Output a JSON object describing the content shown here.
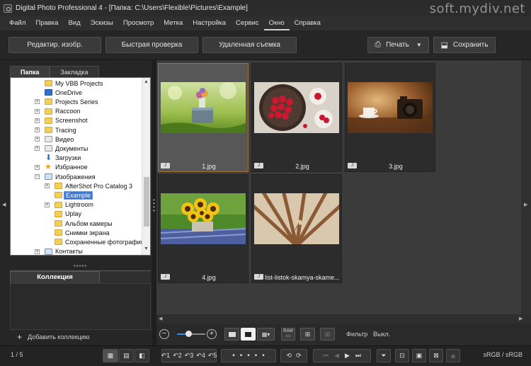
{
  "window": {
    "title": "Digital Photo Professional 4 - [Папка: C:\\Users\\Flexible\\Pictures\\Example]",
    "watermark": "soft.mydiv.net",
    "minimize": "─",
    "maximize": "☐",
    "close": "✕"
  },
  "menu": [
    "Файл",
    "Правка",
    "Вид",
    "Эскизы",
    "Просмотр",
    "Метка",
    "Настройка",
    "Сервис",
    "Окно",
    "Справка"
  ],
  "toolbar": {
    "edit_image": "Редактир. изобр.",
    "quick_check": "Быстрая проверка",
    "remote_shooting": "Удаленная съемка",
    "print": "Печать",
    "save": "Сохранить",
    "print_icon": "⎙",
    "save_icon": "⬓",
    "dropdown": "▼"
  },
  "left_panel": {
    "tab_folder": "Папка",
    "tab_bookmark": "Закладка",
    "tree": [
      {
        "label": "My VBB Projects",
        "icon": "folder",
        "expander": ""
      },
      {
        "label": "OneDrive",
        "icon": "folder-blue",
        "expander": ""
      },
      {
        "label": "Projects Series",
        "icon": "folder",
        "expander": "+"
      },
      {
        "label": "Raccoon",
        "icon": "folder",
        "expander": "+"
      },
      {
        "label": "Screenshot",
        "icon": "folder",
        "expander": "+"
      },
      {
        "label": "Tracing",
        "icon": "folder",
        "expander": "+"
      },
      {
        "label": "Видео",
        "icon": "folder-docs",
        "expander": "+"
      },
      {
        "label": "Документы",
        "icon": "folder-docs",
        "expander": "+"
      },
      {
        "label": "Загрузки",
        "icon": "download",
        "expander": ""
      },
      {
        "label": "Избранное",
        "icon": "star",
        "expander": "+"
      },
      {
        "label": "Изображения",
        "icon": "folder-img",
        "expander": "−"
      },
      {
        "label": "AfterShot Pro Catalog 3",
        "icon": "folder",
        "expander": "+"
      },
      {
        "label": "Example",
        "icon": "folder",
        "expander": "",
        "selected": true
      },
      {
        "label": "Lightroom",
        "icon": "folder",
        "expander": "+"
      },
      {
        "label": "Uplay",
        "icon": "folder",
        "expander": ""
      },
      {
        "label": "Альбом камеры",
        "icon": "folder",
        "expander": ""
      },
      {
        "label": "Снимки экрана",
        "icon": "folder",
        "expander": ""
      },
      {
        "label": "Сохраненные фотографии",
        "icon": "folder",
        "expander": ""
      },
      {
        "label": "Контакты",
        "icon": "folder-img",
        "expander": "+"
      }
    ],
    "collection_tab": "Коллекция",
    "add_collection": "Добавить коллекцию"
  },
  "thumbnails": [
    {
      "name": "1.jpg",
      "badge": "J",
      "selected": true,
      "scene": "nature"
    },
    {
      "name": "2.jpg",
      "badge": "J",
      "selected": false,
      "scene": "raspberries"
    },
    {
      "name": "3.jpg",
      "badge": "J",
      "selected": false,
      "scene": "camera"
    },
    {
      "name": "4.jpg",
      "badge": "J",
      "selected": false,
      "scene": "sunflowers"
    },
    {
      "name": "list-listok-skamya-skame...",
      "badge": "J",
      "selected": false,
      "scene": "bench"
    }
  ],
  "controls": {
    "zoom_minus": "−",
    "zoom_plus": "+",
    "zoom_level": 0.4,
    "raw_label": "RAW",
    "filter_label": "Фильтр",
    "filter_value": "Выкл."
  },
  "status": {
    "page_count": "1 / 5",
    "color_space": "sRGB / sRGB",
    "undo_labels": [
      "↶1",
      "↶2",
      "↶3",
      "↶4",
      "↶5"
    ],
    "rating_dots": "•••••"
  },
  "colors": {
    "selection_border": "#a3703a",
    "accent_blue": "#3a78d8"
  }
}
